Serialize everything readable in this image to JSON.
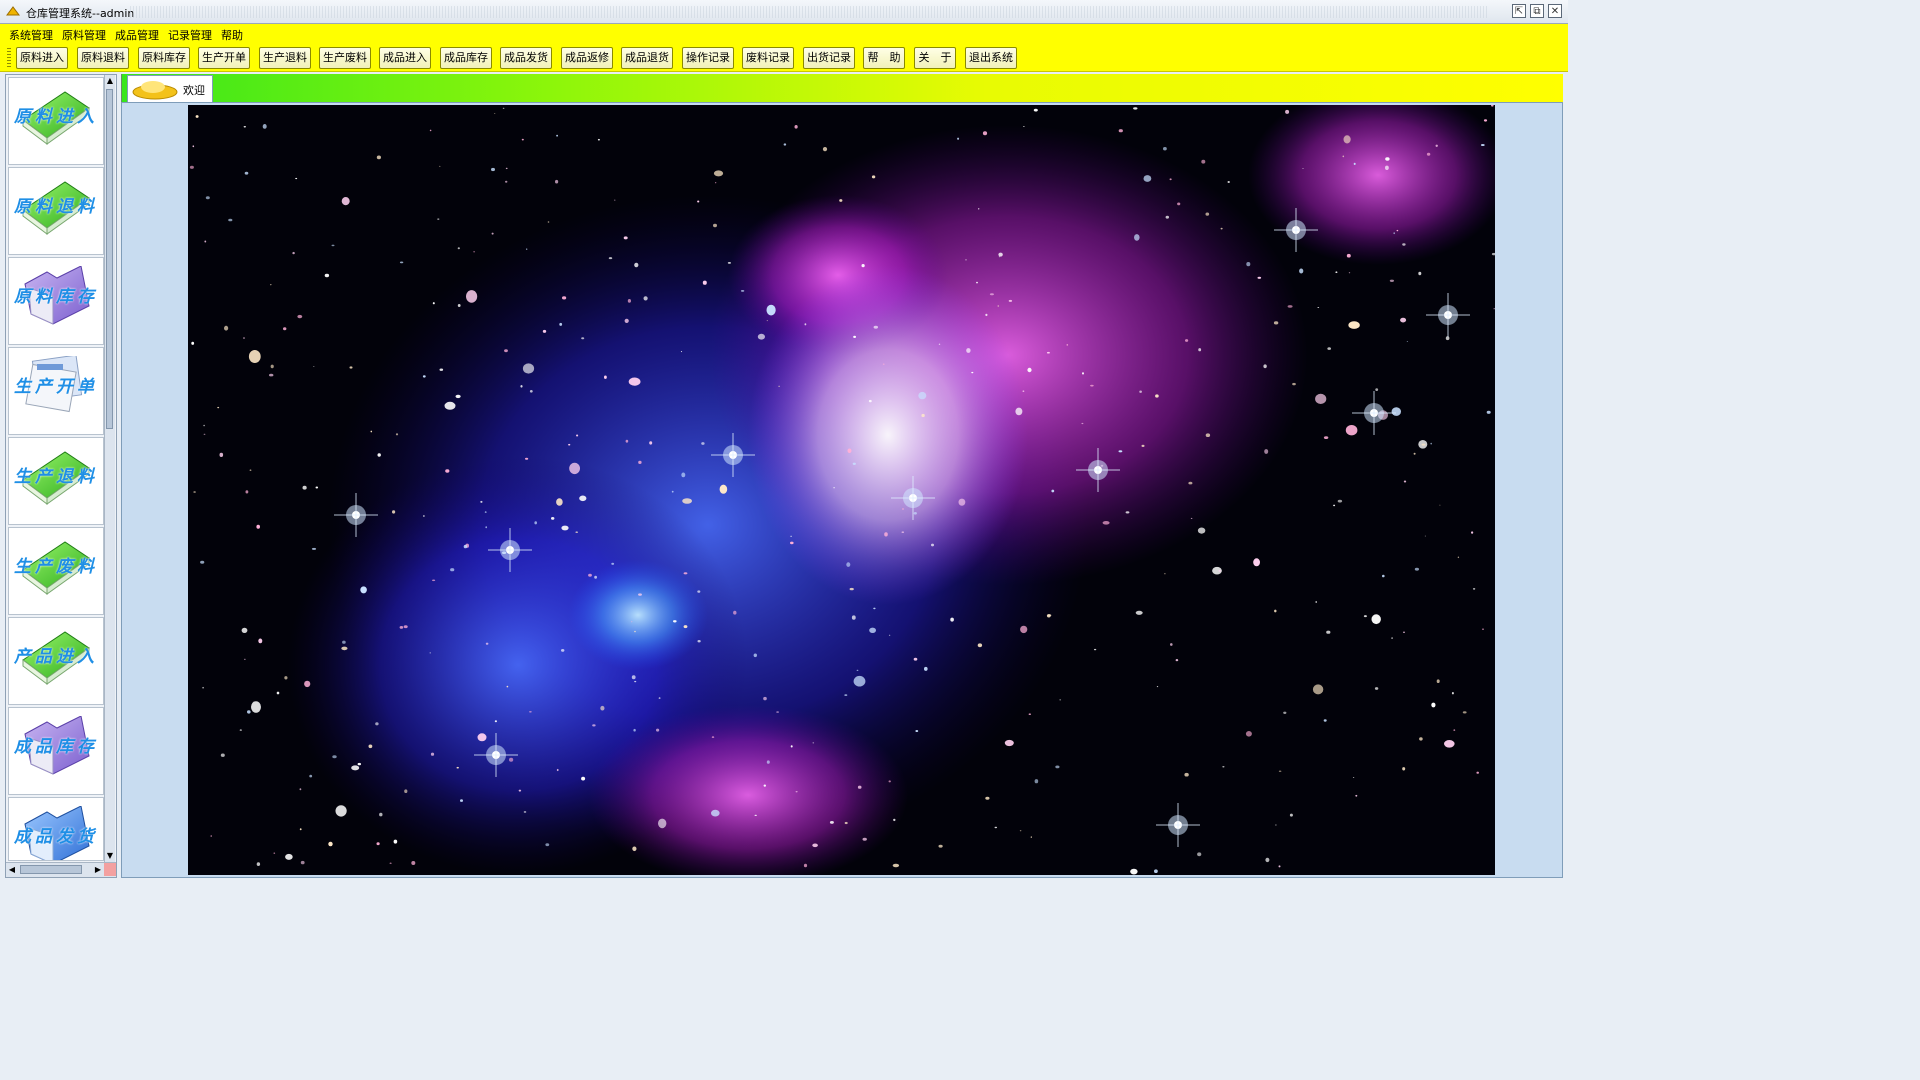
{
  "window": {
    "title": "仓库管理系统--admin",
    "buttons": [
      "⇱",
      "⧉",
      "✕"
    ]
  },
  "menu": [
    "系统管理",
    "原料管理",
    "成品管理",
    "记录管理",
    "帮助"
  ],
  "toolbar": [
    "原料进入",
    "原料退料",
    "原料库存",
    "生产开单",
    "生产退料",
    "生产废料",
    "成品进入",
    "成品库存",
    "成品发货",
    "成品返修",
    "成品退货",
    "操作记录",
    "废料记录",
    "出货记录",
    "帮　助",
    "关　于",
    "退出系统"
  ],
  "sidebar": {
    "items": [
      {
        "label": "原料进入",
        "icon": "green-book-icon"
      },
      {
        "label": "原料退料",
        "icon": "green-book-icon"
      },
      {
        "label": "原料库存",
        "icon": "purple-folder-icon"
      },
      {
        "label": "生产开单",
        "icon": "document-stack-icon"
      },
      {
        "label": "生产退料",
        "icon": "green-book-icon"
      },
      {
        "label": "生产废料",
        "icon": "green-book-icon"
      },
      {
        "label": "产品进入",
        "icon": "green-book-icon"
      },
      {
        "label": "成品库存",
        "icon": "purple-folder-icon"
      },
      {
        "label": "成品发货",
        "icon": "blue-folder-icon"
      }
    ],
    "scroll_up": "▲",
    "scroll_down": "▼",
    "scroll_left": "◀",
    "scroll_right": "▶"
  },
  "tabs": [
    {
      "label": "欢迎",
      "active": true
    }
  ],
  "colors": {
    "menubar": "#ffff00",
    "toolbar": "#ffff00",
    "tab_gradient_start": "#38e61b",
    "accent_label": "#1f8fe6"
  },
  "welcome_image": "galaxy-cluster-space-image"
}
